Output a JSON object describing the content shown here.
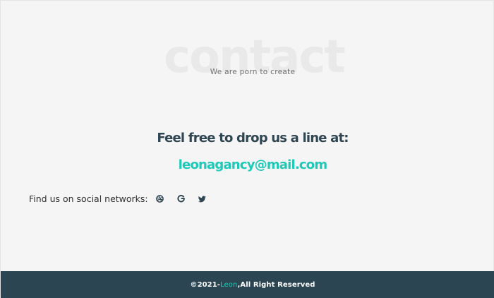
{
  "hero": {
    "bg_word": "contact",
    "tagline": "We are porn to create"
  },
  "contact": {
    "headline": "Feel free to drop us a line at:",
    "email": "leonagancy@mail.com"
  },
  "social": {
    "label": "Find us on social networks:",
    "icons": [
      "dribbble-icon",
      "google-icon",
      "twitter-icon"
    ]
  },
  "footer": {
    "copyright_prefix": "©2021-",
    "brand": "Leon",
    "rights": ",All Right Reserved"
  },
  "colors": {
    "accent": "#1fc9b8",
    "heading": "#2e4552",
    "footer_bg": "#2c4552",
    "background": "#f5f5f5"
  }
}
